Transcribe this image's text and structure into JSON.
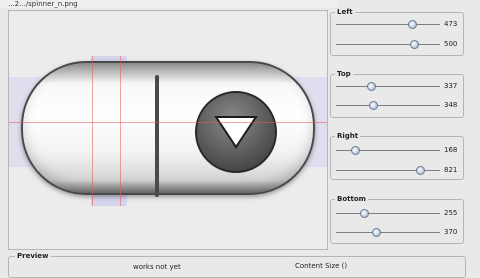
{
  "window": {
    "path": "...2.../spinner_n.png"
  },
  "slices": [
    {
      "title": "Left",
      "sliders": [
        {
          "fraction": 0.73,
          "value": "473"
        },
        {
          "fraction": 0.75,
          "value": "500"
        }
      ]
    },
    {
      "title": "Top",
      "sliders": [
        {
          "fraction": 0.34,
          "value": "337"
        },
        {
          "fraction": 0.36,
          "value": "348"
        }
      ]
    },
    {
      "title": "Right",
      "sliders": [
        {
          "fraction": 0.18,
          "value": "168"
        },
        {
          "fraction": 0.81,
          "value": "821"
        }
      ]
    },
    {
      "title": "Bottom",
      "sliders": [
        {
          "fraction": 0.27,
          "value": "255"
        },
        {
          "fraction": 0.38,
          "value": "370"
        }
      ]
    }
  ],
  "preview": {
    "title": "Preview",
    "message": "works not yet",
    "content_size": "Content Size ()"
  }
}
